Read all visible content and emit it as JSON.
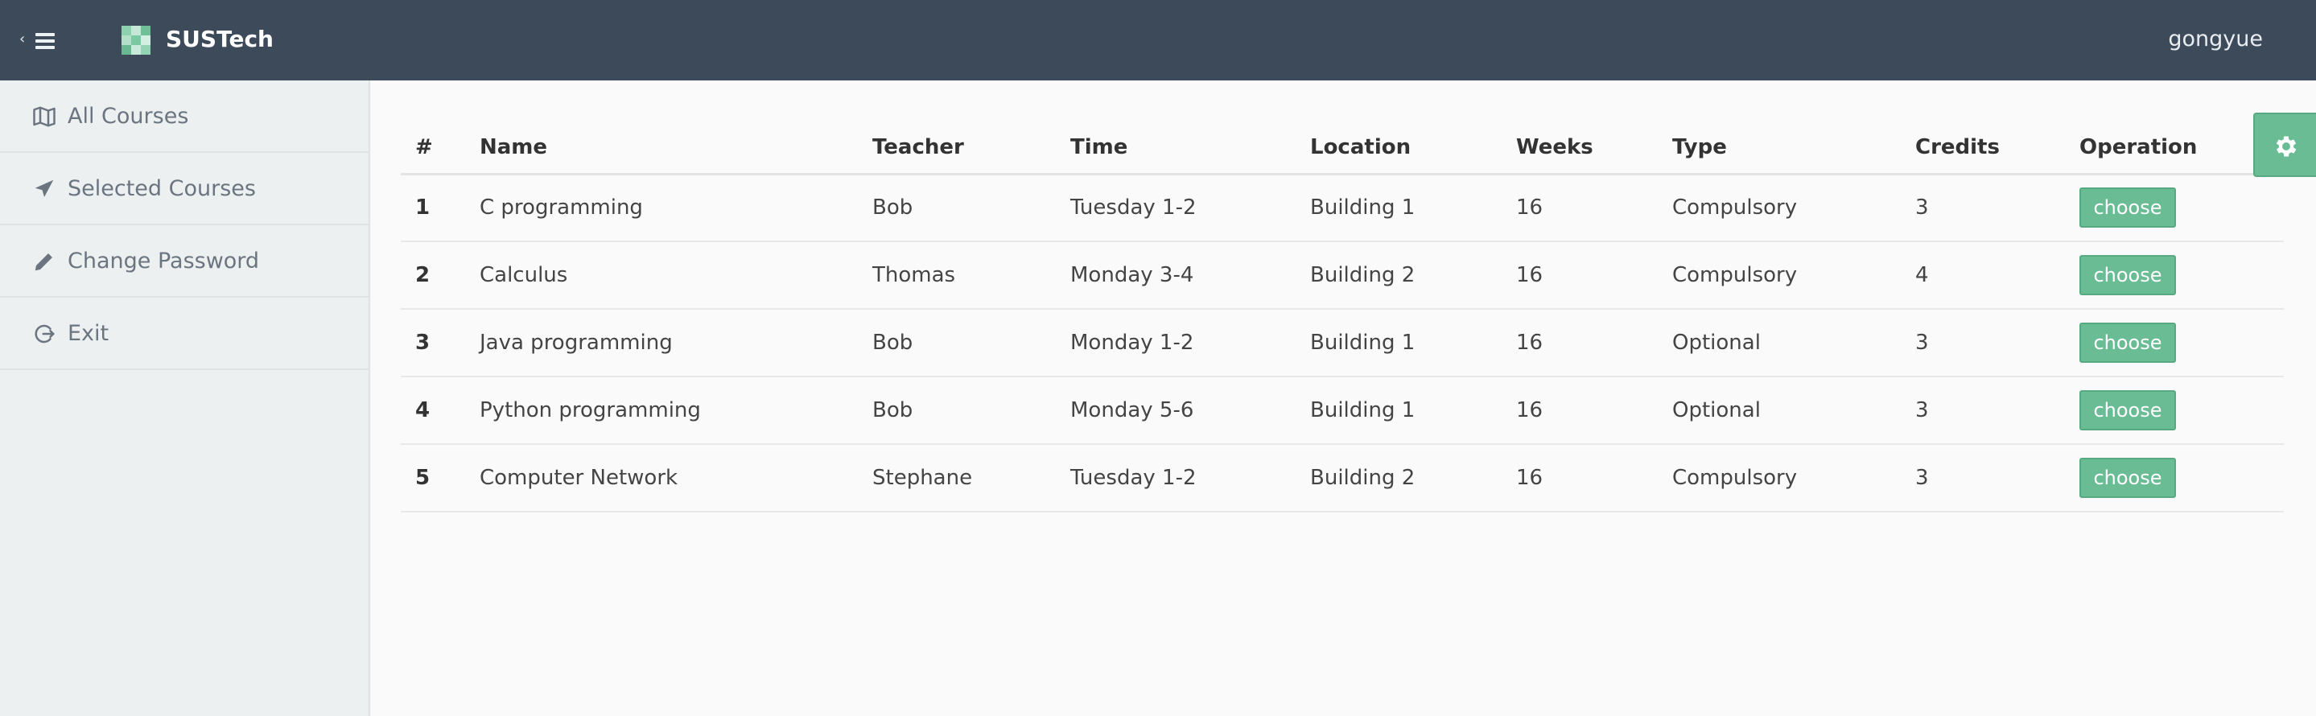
{
  "header": {
    "brand": "SUSTech",
    "username": "gongyue"
  },
  "sidebar": {
    "items": [
      {
        "label": "All Courses",
        "icon": "map-icon"
      },
      {
        "label": "Selected Courses",
        "icon": "send-icon"
      },
      {
        "label": "Change Password",
        "icon": "pencil-icon"
      },
      {
        "label": "Exit",
        "icon": "logout-icon"
      }
    ]
  },
  "table": {
    "headers": [
      "#",
      "Name",
      "Teacher",
      "Time",
      "Location",
      "Weeks",
      "Type",
      "Credits",
      "Operation"
    ],
    "rows": [
      {
        "num": "1",
        "name": "C programming",
        "teacher": "Bob",
        "time": "Tuesday 1-2",
        "location": "Building 1",
        "weeks": "16",
        "type": "Compulsory",
        "credits": "3",
        "action": "choose"
      },
      {
        "num": "2",
        "name": "Calculus",
        "teacher": "Thomas",
        "time": "Monday 3-4",
        "location": "Building 2",
        "weeks": "16",
        "type": "Compulsory",
        "credits": "4",
        "action": "choose"
      },
      {
        "num": "3",
        "name": "Java programming",
        "teacher": "Bob",
        "time": "Monday 1-2",
        "location": "Building 1",
        "weeks": "16",
        "type": "Optional",
        "credits": "3",
        "action": "choose"
      },
      {
        "num": "4",
        "name": "Python programming",
        "teacher": "Bob",
        "time": "Monday 5-6",
        "location": "Building 1",
        "weeks": "16",
        "type": "Optional",
        "credits": "3",
        "action": "choose"
      },
      {
        "num": "5",
        "name": "Computer Network",
        "teacher": "Stephane",
        "time": "Tuesday 1-2",
        "location": "Building 2",
        "weeks": "16",
        "type": "Compulsory",
        "credits": "3",
        "action": "choose"
      }
    ]
  },
  "colors": {
    "header_bg": "#3d4a5a",
    "sidebar_bg": "#ecf0f1",
    "accent": "#6abc94"
  },
  "icons": {
    "menu_toggle": "hamburger-icon",
    "settings": "gear-icon"
  }
}
